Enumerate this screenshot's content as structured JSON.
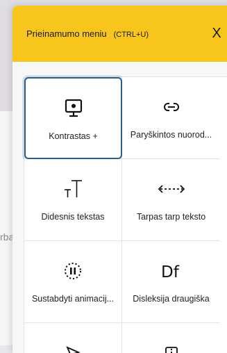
{
  "background": {
    "snippet_text": "rba"
  },
  "menu": {
    "title": "Prieinamumo meniu",
    "shortcut": "(CTRL+U)",
    "close_label": "X",
    "tiles": [
      {
        "label": "Kontrastas +",
        "icon": "monitor-icon",
        "active": true
      },
      {
        "label": "Paryškintos nuorod...",
        "icon": "link-icon",
        "active": false
      },
      {
        "label": "Didesnis tekstas",
        "icon": "text-size-icon",
        "active": false
      },
      {
        "label": "Tarpas tarp teksto",
        "icon": "text-spacing-icon",
        "active": false
      },
      {
        "label": "Sustabdyti animacij...",
        "icon": "pause-animation-icon",
        "active": false
      },
      {
        "label": "Disleksija draugiška",
        "icon": "dyslexia-font-icon",
        "active": false
      },
      {
        "label": "",
        "icon": "cursor-icon",
        "active": false
      },
      {
        "label": "",
        "icon": "info-icon",
        "active": false
      }
    ],
    "colors": {
      "header_bg": "#f8c51d",
      "active_border": "#2b5f8f"
    }
  }
}
